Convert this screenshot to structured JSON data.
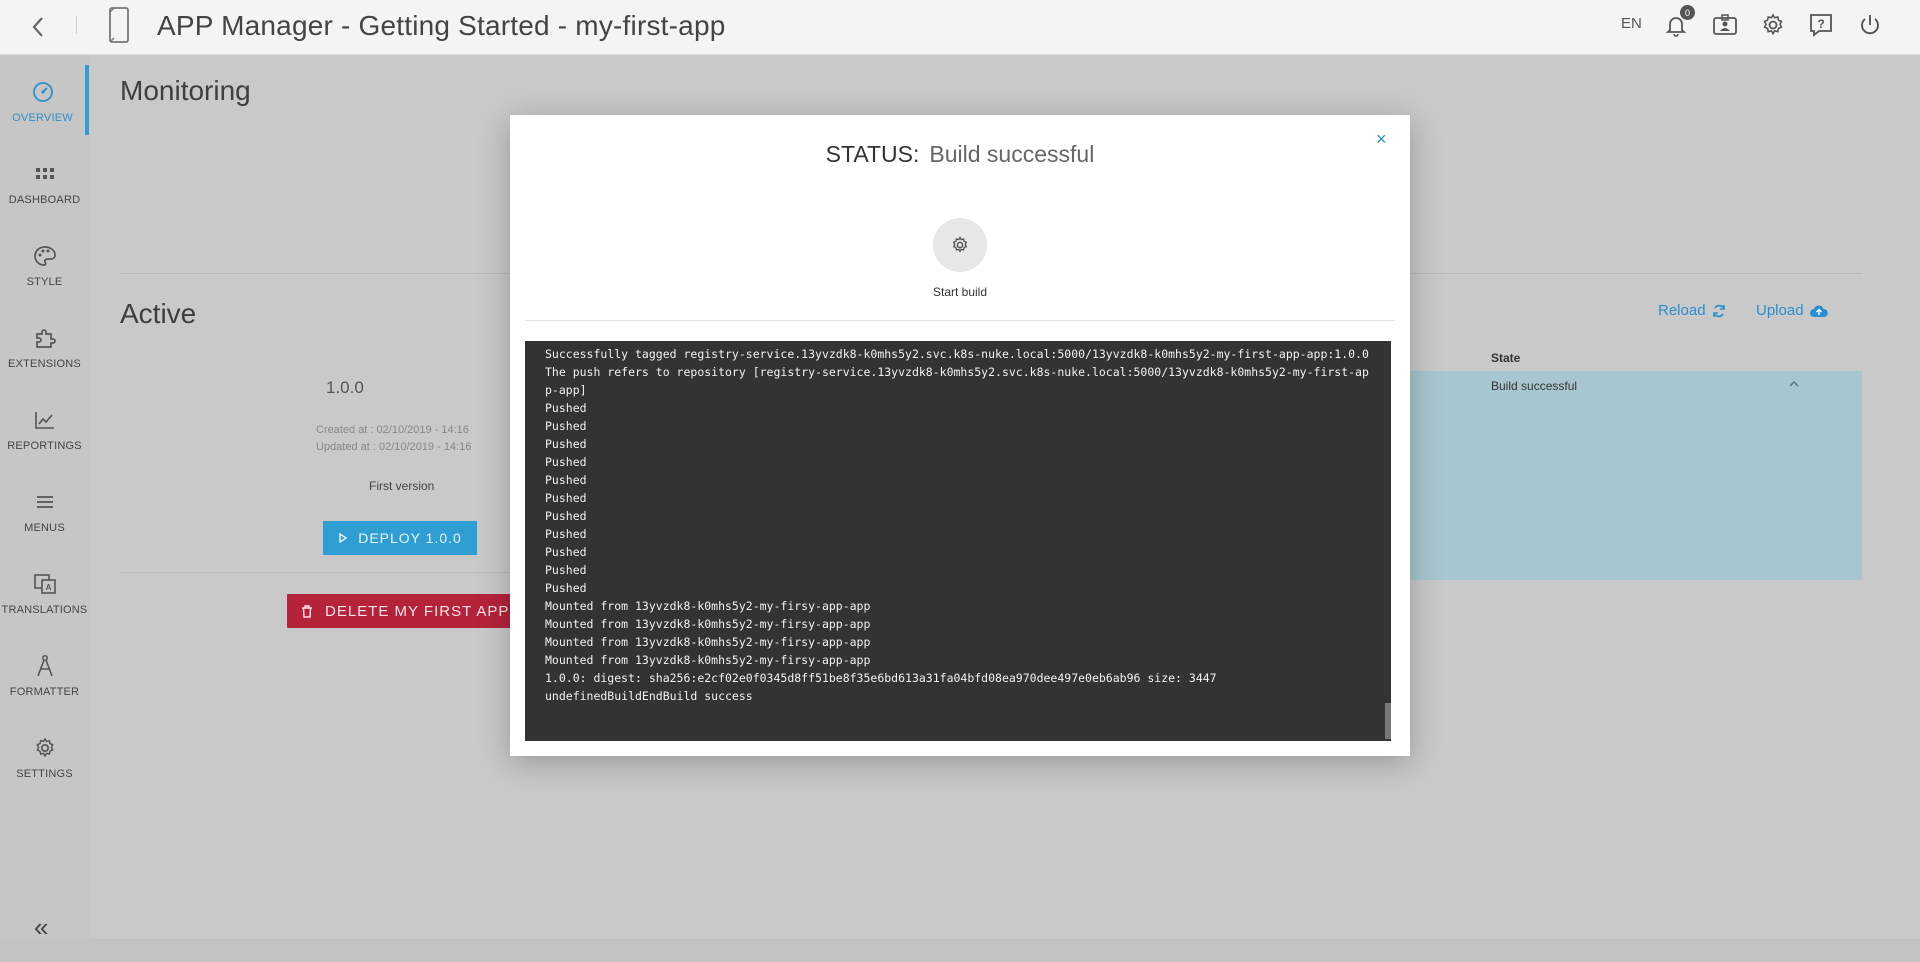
{
  "topbar": {
    "title": "APP Manager - Getting Started - my-first-app",
    "language": "EN",
    "notification_count": "0"
  },
  "sidebar": {
    "items": [
      {
        "label": "OVERVIEW",
        "icon": "gauge-icon"
      },
      {
        "label": "DASHBOARD",
        "icon": "grid-icon"
      },
      {
        "label": "STYLE",
        "icon": "palette-icon"
      },
      {
        "label": "EXTENSIONS",
        "icon": "puzzle-icon"
      },
      {
        "label": "REPORTINGS",
        "icon": "line-chart-icon"
      },
      {
        "label": "MENUS",
        "icon": "hamburger-icon"
      },
      {
        "label": "TRANSLATIONS",
        "icon": "translate-icon"
      },
      {
        "label": "FORMATTER",
        "icon": "compass-icon"
      },
      {
        "label": "SETTINGS",
        "icon": "gear-icon"
      }
    ],
    "collapse_label": "«"
  },
  "main": {
    "page_title": "Monitoring",
    "active_title": "Active",
    "reload_label": "Reload",
    "upload_label": "Upload",
    "version": {
      "number": "1.0.0",
      "created": "Created at : 02/10/2019 - 14:16",
      "updated": "Updated at : 02/10/2019 - 14:16",
      "description": "First version",
      "deploy_label": "DEPLOY 1.0.0"
    },
    "delete_label": "DELETE MY FIRST APP",
    "table": {
      "state_header": "State",
      "state_value": "Build successful"
    }
  },
  "modal": {
    "status_label": "STATUS:",
    "status_value": "Build successful",
    "close_label": "×",
    "start_build_label": "Start build",
    "console_lines": [
      "Successfully tagged registry-service.13yvzdk8-k0mhs5y2.svc.k8s-nuke.local:5000/13yvzdk8-k0mhs5y2-my-first-app-app:1.0.0",
      "The push refers to repository [registry-service.13yvzdk8-k0mhs5y2.svc.k8s-nuke.local:5000/13yvzdk8-k0mhs5y2-my-first-app-app]",
      "Pushed",
      "Pushed",
      "Pushed",
      "Pushed",
      "Pushed",
      "Pushed",
      "Pushed",
      "Pushed",
      "Pushed",
      "Pushed",
      "Pushed",
      "Mounted from 13yvzdk8-k0mhs5y2-my-firsy-app-app",
      "Mounted from 13yvzdk8-k0mhs5y2-my-firsy-app-app",
      "Mounted from 13yvzdk8-k0mhs5y2-my-firsy-app-app",
      "Mounted from 13yvzdk8-k0mhs5y2-my-firsy-app-app",
      "1.0.0: digest: sha256:e2cf02e0f0345d8ff51be8f35e6bd613a31fa04bfd08ea970dee497e0eb6ab96 size: 3447",
      "undefinedBuildEndBuild success"
    ]
  },
  "colors": {
    "accent": "#2f9ed3",
    "danger": "#b5233b",
    "console_bg": "#333333",
    "selected_row": "#a8c6cf"
  }
}
